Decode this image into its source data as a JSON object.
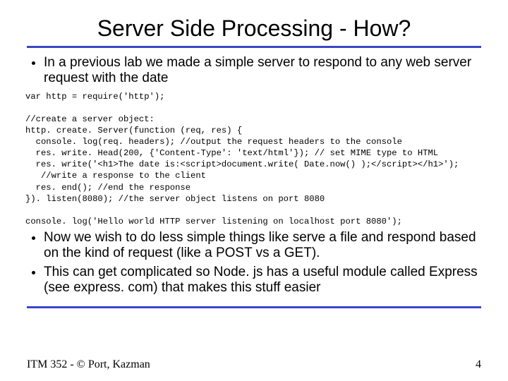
{
  "title": "Server Side Processing - How?",
  "intro_bullet": "In a previous lab we made a simple server to respond to any web server request with the date",
  "code_block": "var http = require('http');\n\n//create a server object:\nhttp. create. Server(function (req, res) {\n  console. log(req. headers); //output the request headers to the console\n  res. write. Head(200, {'Content-Type': 'text/html'}); // set MIME type to HTML\n  res. write('<h1>The date is:<script>document.write( Date.now() );</script></h1>');\n   //write a response to the client\n  res. end(); //end the response\n}). listen(8080); //the server object listens on port 8080\n\nconsole. log('Hello world HTTP server listening on localhost port 8080');",
  "closing_bullets": [
    "Now we wish to do less simple things like serve a file and respond based on the kind of request (like a POST vs a GET).",
    "This can get complicated so Node. js has a useful module called Express (see express. com) that makes this stuff easier"
  ],
  "footer_left": "ITM 352 - © Port, Kazman",
  "footer_right": "4"
}
